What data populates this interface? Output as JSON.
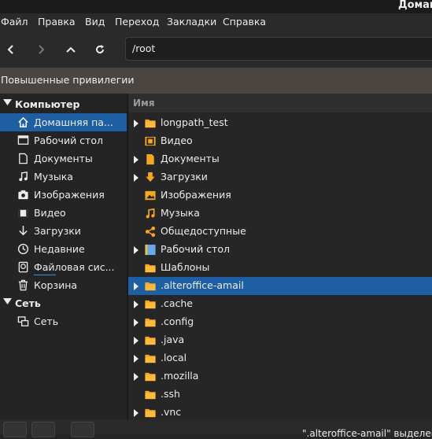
{
  "window": {
    "title": "Домашн"
  },
  "menubar": [
    "Файл",
    "Правка",
    "Вид",
    "Переход",
    "Закладки",
    "Справка"
  ],
  "toolbar": {
    "path": "/root"
  },
  "privilege_banner": "Повышенные привилегии",
  "sidebar": {
    "computer_header": "Компьютер",
    "items": [
      {
        "label": "Домашняя па...",
        "icon": "home-icon",
        "selected": true
      },
      {
        "label": "Рабочий стол",
        "icon": "desktop-icon"
      },
      {
        "label": "Документы",
        "icon": "document-icon"
      },
      {
        "label": "Музыка",
        "icon": "music-icon"
      },
      {
        "label": "Изображения",
        "icon": "camera-icon"
      },
      {
        "label": "Видео",
        "icon": "video-icon"
      },
      {
        "label": "Загрузки",
        "icon": "download-icon"
      },
      {
        "label": "Недавние",
        "icon": "clock-icon"
      },
      {
        "label": "Файловая сис...",
        "icon": "drive-icon"
      },
      {
        "label": "Корзина",
        "icon": "trash-icon"
      }
    ],
    "network_header": "Сеть",
    "network_items": [
      {
        "label": "Сеть",
        "icon": "network-icon"
      }
    ]
  },
  "filelist": {
    "column_name": "Имя",
    "rows": [
      {
        "name": "longpath_test",
        "icon": "folder-icon",
        "expandable": true
      },
      {
        "name": "Видео",
        "icon": "video-folder-icon",
        "expandable": false
      },
      {
        "name": "Документы",
        "icon": "document-folder-icon",
        "expandable": true
      },
      {
        "name": "Загрузки",
        "icon": "download-folder-icon",
        "expandable": true
      },
      {
        "name": "Изображения",
        "icon": "image-folder-icon",
        "expandable": false
      },
      {
        "name": "Музыка",
        "icon": "music-folder-icon",
        "expandable": false
      },
      {
        "name": "Общедоступные",
        "icon": "share-folder-icon",
        "expandable": false
      },
      {
        "name": "Рабочий стол",
        "icon": "desktop-folder-icon",
        "expandable": true
      },
      {
        "name": "Шаблоны",
        "icon": "folder-icon",
        "expandable": false
      },
      {
        "name": ".alteroffice-amail",
        "icon": "folder-icon",
        "expandable": true,
        "selected": true
      },
      {
        "name": ".cache",
        "icon": "folder-icon",
        "expandable": true
      },
      {
        "name": ".config",
        "icon": "folder-icon",
        "expandable": true
      },
      {
        "name": ".java",
        "icon": "folder-icon",
        "expandable": true
      },
      {
        "name": ".local",
        "icon": "folder-icon",
        "expandable": true
      },
      {
        "name": ".mozilla",
        "icon": "folder-icon",
        "expandable": true
      },
      {
        "name": ".ssh",
        "icon": "folder-icon",
        "expandable": false
      },
      {
        "name": ".vnc",
        "icon": "folder-icon",
        "expandable": true
      }
    ]
  },
  "statusbar": {
    "text": "\".alteroffice-amail\" выделен"
  },
  "colors": {
    "selection": "#1e5fa3",
    "folder": "#f5a623",
    "banner": "#4a4540"
  }
}
